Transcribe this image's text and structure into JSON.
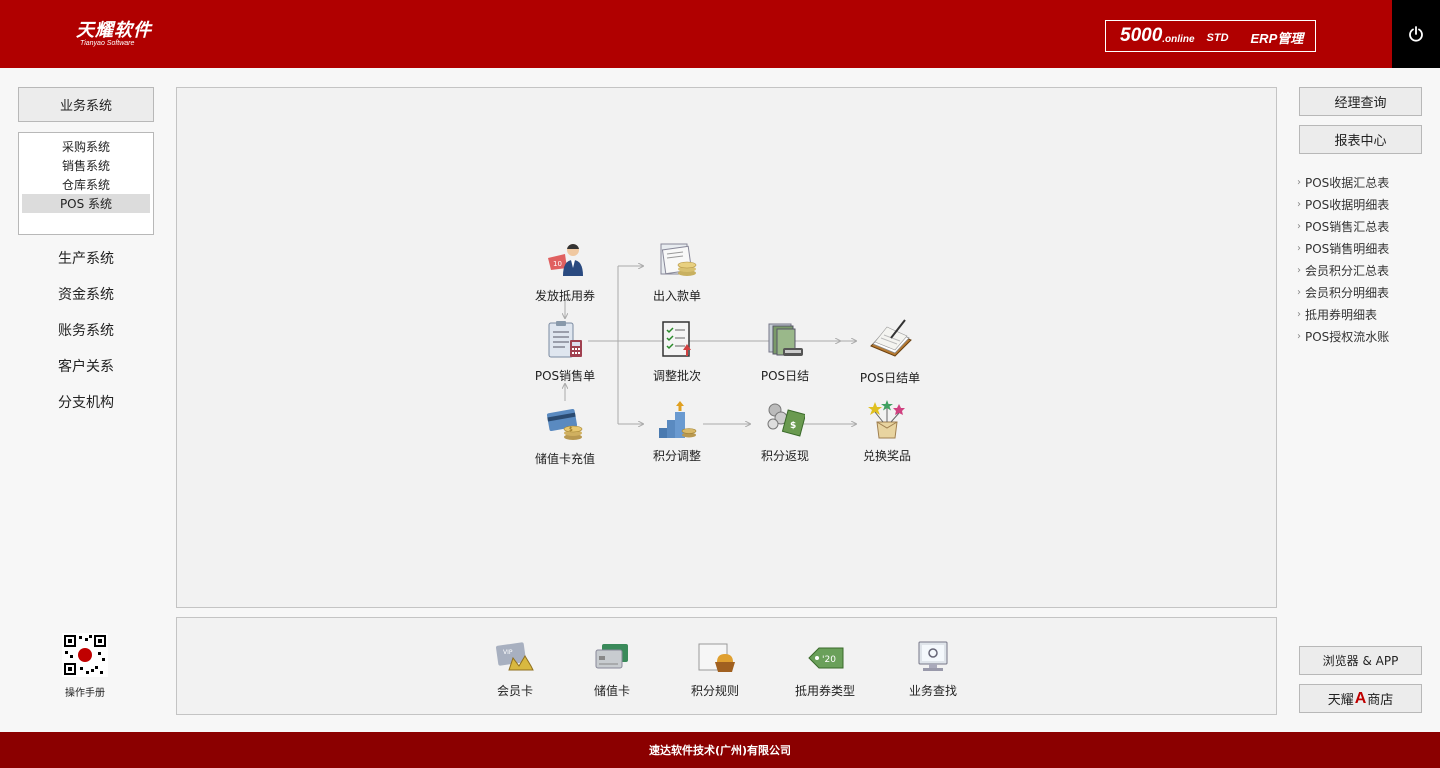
{
  "header": {
    "logo_cn": "天耀软件",
    "logo_en": "Tianyao Software",
    "edition_number": "5000",
    "edition_suffix": ".online",
    "edition_std": "STD",
    "edition_erp": "ERP管理",
    "power_icon": "power-icon"
  },
  "left": {
    "business_button": "业务系统",
    "sub_items": [
      {
        "label": "采购系统",
        "active": false
      },
      {
        "label": "销售系统",
        "active": false
      },
      {
        "label": "仓库系统",
        "active": false
      },
      {
        "label": "POS 系统",
        "active": true
      }
    ],
    "nav": [
      "生产系统",
      "资金系统",
      "账务系统",
      "客户关系",
      "分支机构"
    ],
    "qr_label": "操作手册"
  },
  "flow": {
    "nodes": {
      "issue_voucher": "发放抵用券",
      "cash_in_out": "出入款单",
      "pos_sales": "POS销售单",
      "adjust_batch": "调整批次",
      "pos_daily_close": "POS日结",
      "pos_daily_report": "POS日结单",
      "card_recharge": "储值卡充值",
      "points_adjust": "积分调整",
      "points_cashback": "积分返现",
      "redeem_prize": "兑换奖品"
    }
  },
  "bottom": {
    "items": [
      "会员卡",
      "储值卡",
      "积分规则",
      "抵用券类型",
      "业务查找"
    ]
  },
  "right": {
    "manager_query": "经理查询",
    "report_center": "报表中心",
    "reports": [
      "POS收据汇总表",
      "POS收据明细表",
      "POS销售汇总表",
      "POS销售明细表",
      "会员积分汇总表",
      "会员积分明细表",
      "抵用券明细表",
      "POS授权流水账"
    ],
    "browser_app": "浏览器 & APP",
    "shop_prefix": "天耀",
    "shop_letter": "A",
    "shop_suffix": "商店"
  },
  "footer": {
    "company": "速达软件技术(广州)有限公司"
  },
  "colors": {
    "header_red": "#b00000",
    "footer_red": "#8b0000",
    "panel_bg": "#f2f2f2"
  }
}
